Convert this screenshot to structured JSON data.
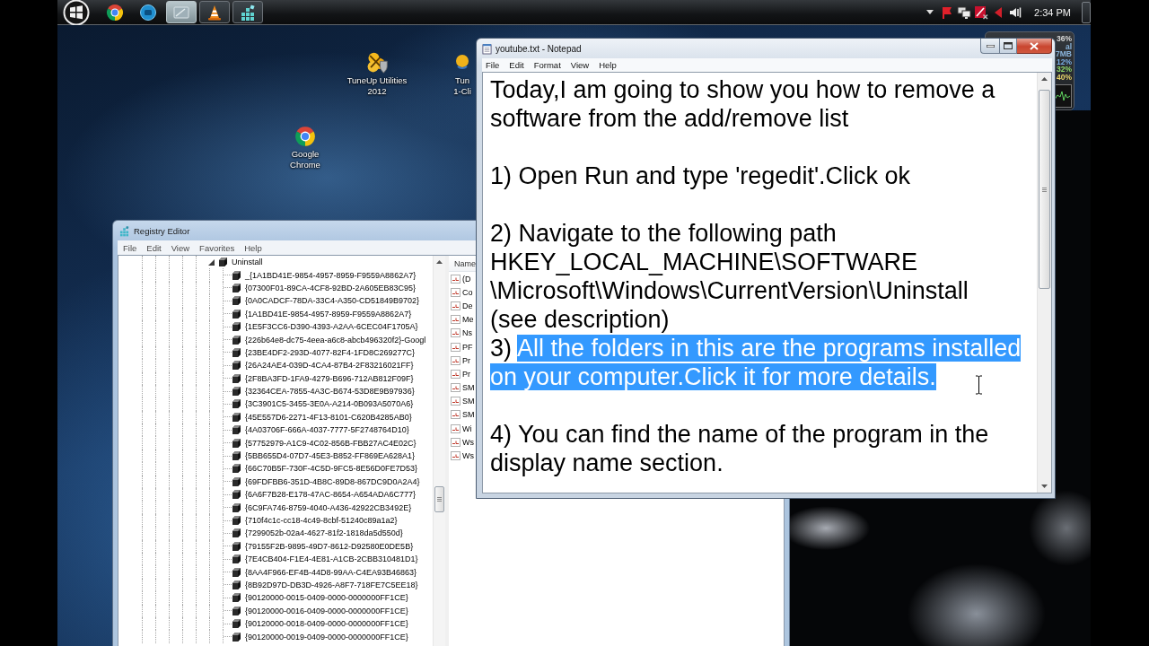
{
  "taskbar": {
    "buttons": [
      {
        "running": false,
        "selected": false
      },
      {
        "running": false,
        "selected": false
      },
      {
        "running": true,
        "selected": true
      },
      {
        "running": true,
        "selected": false
      },
      {
        "running": true,
        "selected": false
      }
    ],
    "clock": "2:34 PM"
  },
  "desktop_icons": [
    {
      "label": "TuneUp Utilities 2012"
    },
    {
      "label": "Tun 1-Cli"
    },
    {
      "label": "Google Chrome"
    }
  ],
  "gadget": {
    "readings": [
      {
        "text": "36%",
        "color": "#d9d9d9"
      },
      {
        "text": "al",
        "color": "#8ab4dc"
      },
      {
        "text": "7MB",
        "color": "#8ab4dc"
      },
      {
        "text": "12%",
        "color": "#79aee6"
      },
      {
        "text": "32%",
        "color": "#8fd86a"
      },
      {
        "text": "40%",
        "color": "#e6d36a"
      }
    ]
  },
  "registry_editor": {
    "title": "Registry Editor",
    "menu": [
      "File",
      "Edit",
      "View",
      "Favorites",
      "Help"
    ],
    "tree": {
      "label": "Uninstall",
      "expanded": true,
      "selected": false,
      "children": [
        {
          "label": "_{1A1BD41E-9854-4957-8959-F9559A8862A7}",
          "selected": false
        },
        {
          "label": "{07300F01-89CA-4CF8-92BD-2A605EB83C95}",
          "selected": false
        },
        {
          "label": "{0A0CADCF-78DA-33C4-A350-CD51849B9702}",
          "selected": false
        },
        {
          "label": "{1A1BD41E-9854-4957-8959-F9559A8862A7}",
          "selected": false
        },
        {
          "label": "{1E5F3CC6-D390-4393-A2AA-6CEC04F1705A}",
          "selected": false
        },
        {
          "label": "{226b64e8-dc75-4eea-a6c8-abcb496320f2}-Googl",
          "selected": false
        },
        {
          "label": "{23BE4DF2-293D-4077-82F4-1FD8C269277C}",
          "selected": false
        },
        {
          "label": "{26A24AE4-039D-4CA4-87B4-2F83216021FF}",
          "selected": false
        },
        {
          "label": "{2F8BA3FD-1FA9-4279-B696-712AB812F09F}",
          "selected": false
        },
        {
          "label": "{32364CEA-7855-4A3C-B674-53D8E9B97936}",
          "selected": false
        },
        {
          "label": "{3C3901C5-3455-3E0A-A214-0B093A5070A6}",
          "selected": false
        },
        {
          "label": "{45E557D6-2271-4F13-8101-C620B4285AB0}",
          "selected": false
        },
        {
          "label": "{4A03706F-666A-4037-7777-5F2748764D10}",
          "selected": false
        },
        {
          "label": "{57752979-A1C9-4C02-856B-FBB27AC4E02C}",
          "selected": false
        },
        {
          "label": "{5BB655D4-07D7-45E3-B852-FF869EA628A1}",
          "selected": false
        },
        {
          "label": "{66C70B5F-730F-4C5D-9FC5-8E56D0FE7D53}",
          "selected": false
        },
        {
          "label": "{69FDFBB6-351D-4B8C-89D8-867DC9D0A2A4}",
          "selected": false
        },
        {
          "label": "{6A6F7B28-E178-47AC-8654-A654ADA6C777}",
          "selected": false
        },
        {
          "label": "{6C9FA746-8759-4040-A436-42922CB3492E}",
          "selected": false
        },
        {
          "label": "{710f4c1c-cc18-4c49-8cbf-51240c89a1a2}",
          "selected": false
        },
        {
          "label": "{7299052b-02a4-4627-81f2-1818da5d550d}",
          "selected": false
        },
        {
          "label": "{79155F2B-9895-49D7-8612-D92580E0DE5B}",
          "selected": false
        },
        {
          "label": "{7E4CB404-F1E4-4E81-A1CB-2CBB310481D1}",
          "selected": false
        },
        {
          "label": "{8AA4F966-EF4B-44D8-99AA-C4EA93B46863}",
          "selected": false
        },
        {
          "label": "{8B92D97D-DB3D-4926-A8F7-718FE7C5EE18}",
          "selected": false
        },
        {
          "label": "{90120000-0015-0409-0000-0000000FF1CE}",
          "selected": false
        },
        {
          "label": "{90120000-0016-0409-0000-0000000FF1CE}",
          "selected": false
        },
        {
          "label": "{90120000-0018-0409-0000-0000000FF1CE}",
          "selected": false
        },
        {
          "label": "{90120000-0019-0409-0000-0000000FF1CE}",
          "selected": false
        }
      ]
    },
    "values": {
      "column": "Name",
      "items": [
        "(D",
        "Co",
        "De",
        "Me",
        "Ns",
        "PF",
        "Pr",
        "Pr",
        "SM",
        "SM",
        "SM",
        "Wi",
        "Ws",
        "Ws"
      ]
    }
  },
  "notepad": {
    "title": "youtube.txt - Notepad",
    "menu": [
      "File",
      "Edit",
      "Format",
      "View",
      "Help"
    ],
    "paragraphs": [
      {
        "lines": [
          {
            "runs": [
              {
                "text": "Today,I am going to show you how to remove a",
                "selected": false
              }
            ]
          },
          {
            "runs": [
              {
                "text": "software from the add/remove list",
                "selected": false
              }
            ]
          }
        ]
      },
      {
        "lines": [
          {
            "runs": [
              {
                "text": "1) Open Run and type 'regedit'.Click ok",
                "selected": false
              }
            ]
          }
        ]
      },
      {
        "lines": [
          {
            "runs": [
              {
                "text": "2) Navigate to the following path",
                "selected": false
              }
            ]
          },
          {
            "runs": [
              {
                "text": "HKEY_LOCAL_MACHINE\\SOFTWARE",
                "selected": false
              }
            ]
          },
          {
            "runs": [
              {
                "text": "\\Microsoft\\Windows\\CurrentVersion\\Uninstall",
                "selected": false
              }
            ]
          },
          {
            "runs": [
              {
                "text": "(see description)",
                "selected": false
              }
            ]
          },
          {
            "runs": [
              {
                "text": "3) ",
                "selected": false
              },
              {
                "text": "All the folders in this are the programs installed",
                "selected": true
              }
            ]
          },
          {
            "runs": [
              {
                "text": "on your computer.Click it for more details.",
                "selected": true
              }
            ]
          }
        ]
      },
      {
        "lines": [
          {
            "runs": [
              {
                "text": "4) You can find the name of the program in the",
                "selected": false
              }
            ]
          },
          {
            "runs": [
              {
                "text": "display name section.",
                "selected": false
              }
            ]
          }
        ]
      }
    ]
  }
}
